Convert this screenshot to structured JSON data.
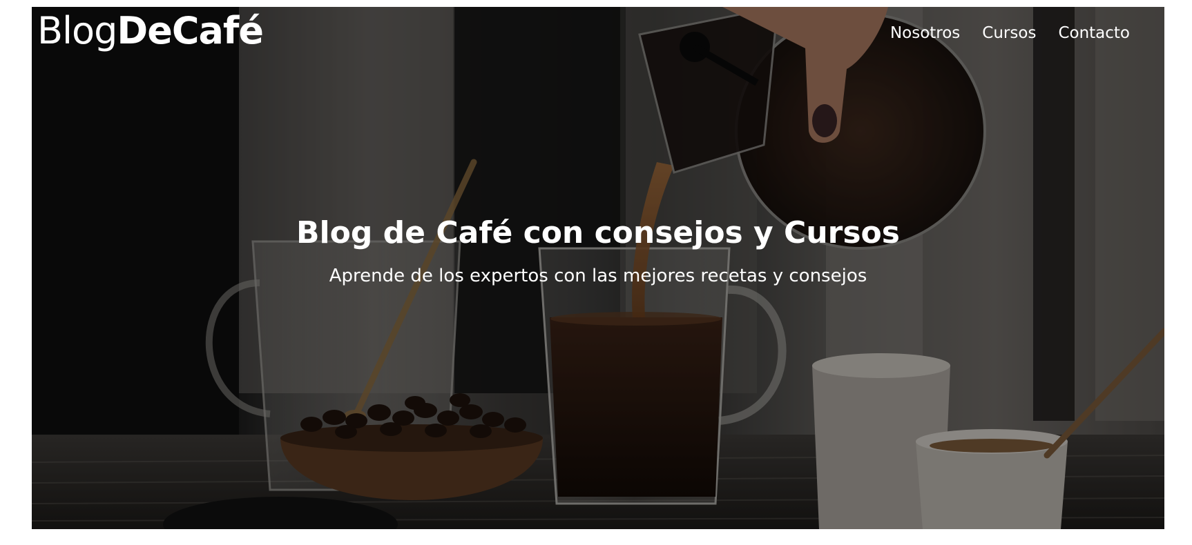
{
  "brand": {
    "logo_light": "Blog",
    "logo_bold": "DeCafé"
  },
  "nav": {
    "items": [
      {
        "label": "Nosotros"
      },
      {
        "label": "Cursos"
      },
      {
        "label": "Contacto"
      }
    ]
  },
  "hero": {
    "title": "Blog de Café con consejos y Cursos",
    "subtitle": "Aprende de los expertos con las mejores recetas y consejos",
    "image_description_icon": "coffee-pour-photo"
  },
  "colors": {
    "text": "#ffffff",
    "overlay": "#000000",
    "coffee_dark": "#1b0f0a",
    "bean": "#2a1a12",
    "wood": "#5a3a22"
  }
}
